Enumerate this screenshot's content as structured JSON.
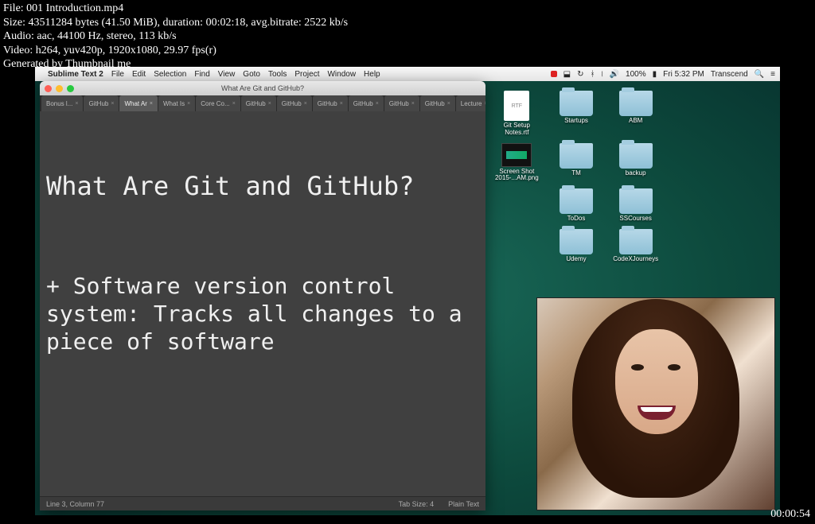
{
  "overlay": {
    "line1": "File: 001 Introduction.mp4",
    "line2": "Size: 43511284 bytes (41.50 MiB), duration: 00:02:18, avg.bitrate: 2522 kb/s",
    "line3": "Audio: aac, 44100 Hz, stereo, 113 kb/s",
    "line4": "Video: h264, yuv420p, 1920x1080, 29.97 fps(r)",
    "line5": "Generated by Thumbnail me",
    "timestamp": "00:00:54"
  },
  "mac_menu": {
    "apple": "",
    "app": "Sublime Text 2",
    "items": [
      "File",
      "Edit",
      "Selection",
      "Find",
      "View",
      "Goto",
      "Tools",
      "Project",
      "Window",
      "Help"
    ],
    "right": {
      "battery": "100%",
      "day_time": "Fri 5:32 PM",
      "user": "Transcend"
    }
  },
  "sublime": {
    "title": "What Are Git and GitHub?",
    "tabs": [
      {
        "label": "Bonus l..."
      },
      {
        "label": "GitHub"
      },
      {
        "label": "What Ar",
        "active": true
      },
      {
        "label": "What Is"
      },
      {
        "label": "Core Co..."
      },
      {
        "label": "GitHub"
      },
      {
        "label": "GitHub"
      },
      {
        "label": "GitHub"
      },
      {
        "label": "GitHub"
      },
      {
        "label": "GitHub"
      },
      {
        "label": "GitHub"
      },
      {
        "label": "Lecture"
      }
    ],
    "editor_heading": "What Are Git and GitHub?",
    "editor_body": "+ Software version control system: Tracks all changes to a piece of software",
    "status": {
      "left": "Line 3, Column 77",
      "tab_size": "Tab Size: 4",
      "syntax": "Plain Text"
    }
  },
  "desktop_icons": [
    {
      "label": "Git Setup Notes.rtf",
      "type": "file",
      "badge": "RTF"
    },
    {
      "label": "Startups",
      "type": "folder"
    },
    {
      "label": "ABM",
      "type": "folder"
    },
    {
      "label": "Screen Shot 2015-...AM.png",
      "type": "image"
    },
    {
      "label": "TM",
      "type": "folder"
    },
    {
      "label": "backup",
      "type": "folder"
    },
    {
      "label": "",
      "type": "spacer"
    },
    {
      "label": "ToDos",
      "type": "folder"
    },
    {
      "label": "SSCourses",
      "type": "folder"
    },
    {
      "label": "",
      "type": "spacer"
    },
    {
      "label": "Udemy",
      "type": "folder"
    },
    {
      "label": "CodeXJourneys",
      "type": "folder"
    }
  ]
}
